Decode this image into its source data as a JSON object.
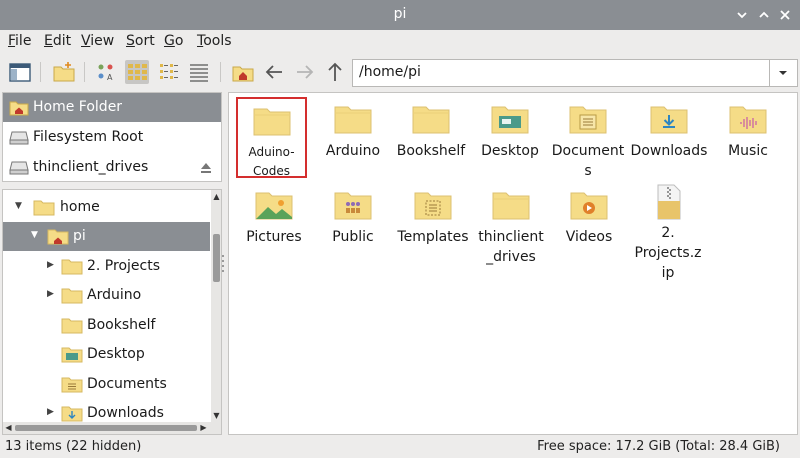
{
  "window": {
    "title": "pi"
  },
  "menu": [
    {
      "label": "File",
      "accel": "F",
      "rest": "ile"
    },
    {
      "label": "Edit",
      "accel": "E",
      "rest": "dit"
    },
    {
      "label": "View",
      "accel": "V",
      "rest": "iew"
    },
    {
      "label": "Sort",
      "accel": "S",
      "rest": "ort"
    },
    {
      "label": "Go",
      "accel": "G",
      "rest": "o"
    },
    {
      "label": "Tools",
      "accel": "T",
      "rest": "ools"
    }
  ],
  "toolbar": {
    "path": "/home/pi",
    "buttons": [
      "sidebar-toggle-icon",
      "new-folder-icon",
      "icon-view-icon",
      "thumbnail-view-icon",
      "compact-view-icon",
      "list-view-icon",
      "home-icon",
      "back-arrow-icon",
      "forward-arrow-icon",
      "up-arrow-icon"
    ]
  },
  "places": [
    {
      "label": "Home Folder",
      "icon": "home-folder-icon",
      "selected": true
    },
    {
      "label": "Filesystem Root",
      "icon": "drive-icon",
      "selected": false
    },
    {
      "label": "thinclient_drives",
      "icon": "drive-icon",
      "selected": false,
      "eject": true
    }
  ],
  "tree": [
    {
      "label": "home"
    },
    {
      "label": "pi"
    },
    {
      "label": "2. Projects"
    },
    {
      "label": "Arduino"
    },
    {
      "label": "Bookshelf"
    },
    {
      "label": "Desktop"
    },
    {
      "label": "Documents"
    },
    {
      "label": "Downloads"
    }
  ],
  "files": [
    {
      "name": "Aduino-Codes",
      "icon": "folder-icon",
      "highlighted": true
    },
    {
      "name": "Arduino",
      "icon": "folder-icon"
    },
    {
      "name": "Bookshelf",
      "icon": "folder-icon"
    },
    {
      "name": "Desktop",
      "icon": "desktop-folder-icon"
    },
    {
      "name": "Documents",
      "icon": "documents-folder-icon"
    },
    {
      "name": "Downloads",
      "icon": "downloads-folder-icon"
    },
    {
      "name": "Music",
      "icon": "music-folder-icon"
    },
    {
      "name": "Pictures",
      "icon": "pictures-folder-icon"
    },
    {
      "name": "Public",
      "icon": "public-folder-icon"
    },
    {
      "name": "Templates",
      "icon": "templates-folder-icon"
    },
    {
      "name": "thinclient_drives",
      "icon": "folder-icon"
    },
    {
      "name": "Videos",
      "icon": "videos-folder-icon"
    },
    {
      "name": "2. Projects.zip",
      "icon": "zip-file-icon"
    }
  ],
  "status": {
    "left": "13 items (22 hidden)",
    "right": "Free space: 17.2 GiB (Total: 28.4 GiB)"
  },
  "colors": {
    "titlebar": "#8a8e93",
    "selection": "#8a8e93",
    "folder": "#f5dc87",
    "highlight_border": "#d42e2e"
  }
}
